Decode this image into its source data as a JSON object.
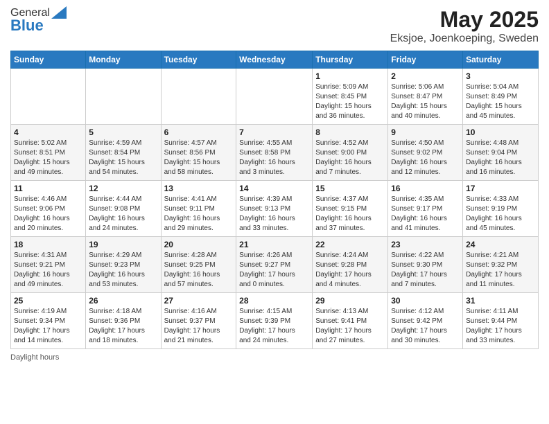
{
  "header": {
    "logo_general": "General",
    "logo_blue": "Blue",
    "title": "May 2025",
    "subtitle": "Eksjoe, Joenkoeping, Sweden"
  },
  "days_of_week": [
    "Sunday",
    "Monday",
    "Tuesday",
    "Wednesday",
    "Thursday",
    "Friday",
    "Saturday"
  ],
  "weeks": [
    [
      {
        "day": "",
        "info": ""
      },
      {
        "day": "",
        "info": ""
      },
      {
        "day": "",
        "info": ""
      },
      {
        "day": "",
        "info": ""
      },
      {
        "day": "1",
        "info": "Sunrise: 5:09 AM\nSunset: 8:45 PM\nDaylight: 15 hours\nand 36 minutes."
      },
      {
        "day": "2",
        "info": "Sunrise: 5:06 AM\nSunset: 8:47 PM\nDaylight: 15 hours\nand 40 minutes."
      },
      {
        "day": "3",
        "info": "Sunrise: 5:04 AM\nSunset: 8:49 PM\nDaylight: 15 hours\nand 45 minutes."
      }
    ],
    [
      {
        "day": "4",
        "info": "Sunrise: 5:02 AM\nSunset: 8:51 PM\nDaylight: 15 hours\nand 49 minutes."
      },
      {
        "day": "5",
        "info": "Sunrise: 4:59 AM\nSunset: 8:54 PM\nDaylight: 15 hours\nand 54 minutes."
      },
      {
        "day": "6",
        "info": "Sunrise: 4:57 AM\nSunset: 8:56 PM\nDaylight: 15 hours\nand 58 minutes."
      },
      {
        "day": "7",
        "info": "Sunrise: 4:55 AM\nSunset: 8:58 PM\nDaylight: 16 hours\nand 3 minutes."
      },
      {
        "day": "8",
        "info": "Sunrise: 4:52 AM\nSunset: 9:00 PM\nDaylight: 16 hours\nand 7 minutes."
      },
      {
        "day": "9",
        "info": "Sunrise: 4:50 AM\nSunset: 9:02 PM\nDaylight: 16 hours\nand 12 minutes."
      },
      {
        "day": "10",
        "info": "Sunrise: 4:48 AM\nSunset: 9:04 PM\nDaylight: 16 hours\nand 16 minutes."
      }
    ],
    [
      {
        "day": "11",
        "info": "Sunrise: 4:46 AM\nSunset: 9:06 PM\nDaylight: 16 hours\nand 20 minutes."
      },
      {
        "day": "12",
        "info": "Sunrise: 4:44 AM\nSunset: 9:08 PM\nDaylight: 16 hours\nand 24 minutes."
      },
      {
        "day": "13",
        "info": "Sunrise: 4:41 AM\nSunset: 9:11 PM\nDaylight: 16 hours\nand 29 minutes."
      },
      {
        "day": "14",
        "info": "Sunrise: 4:39 AM\nSunset: 9:13 PM\nDaylight: 16 hours\nand 33 minutes."
      },
      {
        "day": "15",
        "info": "Sunrise: 4:37 AM\nSunset: 9:15 PM\nDaylight: 16 hours\nand 37 minutes."
      },
      {
        "day": "16",
        "info": "Sunrise: 4:35 AM\nSunset: 9:17 PM\nDaylight: 16 hours\nand 41 minutes."
      },
      {
        "day": "17",
        "info": "Sunrise: 4:33 AM\nSunset: 9:19 PM\nDaylight: 16 hours\nand 45 minutes."
      }
    ],
    [
      {
        "day": "18",
        "info": "Sunrise: 4:31 AM\nSunset: 9:21 PM\nDaylight: 16 hours\nand 49 minutes."
      },
      {
        "day": "19",
        "info": "Sunrise: 4:29 AM\nSunset: 9:23 PM\nDaylight: 16 hours\nand 53 minutes."
      },
      {
        "day": "20",
        "info": "Sunrise: 4:28 AM\nSunset: 9:25 PM\nDaylight: 16 hours\nand 57 minutes."
      },
      {
        "day": "21",
        "info": "Sunrise: 4:26 AM\nSunset: 9:27 PM\nDaylight: 17 hours\nand 0 minutes."
      },
      {
        "day": "22",
        "info": "Sunrise: 4:24 AM\nSunset: 9:28 PM\nDaylight: 17 hours\nand 4 minutes."
      },
      {
        "day": "23",
        "info": "Sunrise: 4:22 AM\nSunset: 9:30 PM\nDaylight: 17 hours\nand 7 minutes."
      },
      {
        "day": "24",
        "info": "Sunrise: 4:21 AM\nSunset: 9:32 PM\nDaylight: 17 hours\nand 11 minutes."
      }
    ],
    [
      {
        "day": "25",
        "info": "Sunrise: 4:19 AM\nSunset: 9:34 PM\nDaylight: 17 hours\nand 14 minutes."
      },
      {
        "day": "26",
        "info": "Sunrise: 4:18 AM\nSunset: 9:36 PM\nDaylight: 17 hours\nand 18 minutes."
      },
      {
        "day": "27",
        "info": "Sunrise: 4:16 AM\nSunset: 9:37 PM\nDaylight: 17 hours\nand 21 minutes."
      },
      {
        "day": "28",
        "info": "Sunrise: 4:15 AM\nSunset: 9:39 PM\nDaylight: 17 hours\nand 24 minutes."
      },
      {
        "day": "29",
        "info": "Sunrise: 4:13 AM\nSunset: 9:41 PM\nDaylight: 17 hours\nand 27 minutes."
      },
      {
        "day": "30",
        "info": "Sunrise: 4:12 AM\nSunset: 9:42 PM\nDaylight: 17 hours\nand 30 minutes."
      },
      {
        "day": "31",
        "info": "Sunrise: 4:11 AM\nSunset: 9:44 PM\nDaylight: 17 hours\nand 33 minutes."
      }
    ]
  ],
  "footer": {
    "daylight_hours": "Daylight hours"
  }
}
